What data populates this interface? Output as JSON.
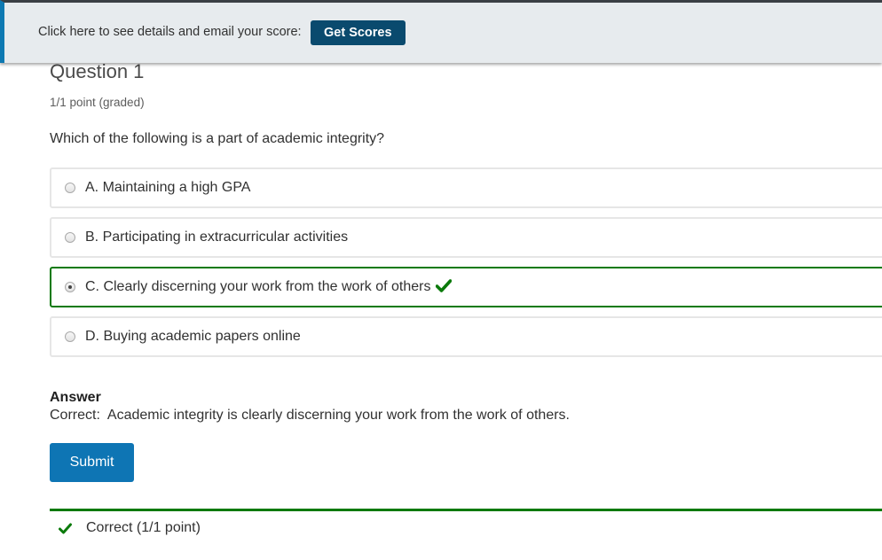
{
  "banner": {
    "text": "Click here to see details and email your score:",
    "button_label": "Get Scores"
  },
  "question": {
    "title": "Question 1",
    "points": "1/1 point (graded)",
    "prompt": "Which of the following is a part of academic integrity?",
    "options": [
      {
        "label": "A. Maintaining a high GPA",
        "selected": false
      },
      {
        "label": "B. Participating in extracurricular activities",
        "selected": false
      },
      {
        "label": "C. Clearly discerning your work from the work of others",
        "selected": true,
        "icon": "checkmark-icon"
      },
      {
        "label": "D. Buying academic papers online",
        "selected": false
      }
    ]
  },
  "answer": {
    "heading": "Answer",
    "text": "Correct:  Academic integrity is clearly discerning your work from the work of others."
  },
  "submit_label": "Submit",
  "status": {
    "text": "Correct (1/1 point)",
    "icon": "checkmark-icon"
  },
  "colors": {
    "accent": "#0e75b4",
    "banner_button": "#0a4a6e",
    "correct": "#0b7a0b"
  }
}
